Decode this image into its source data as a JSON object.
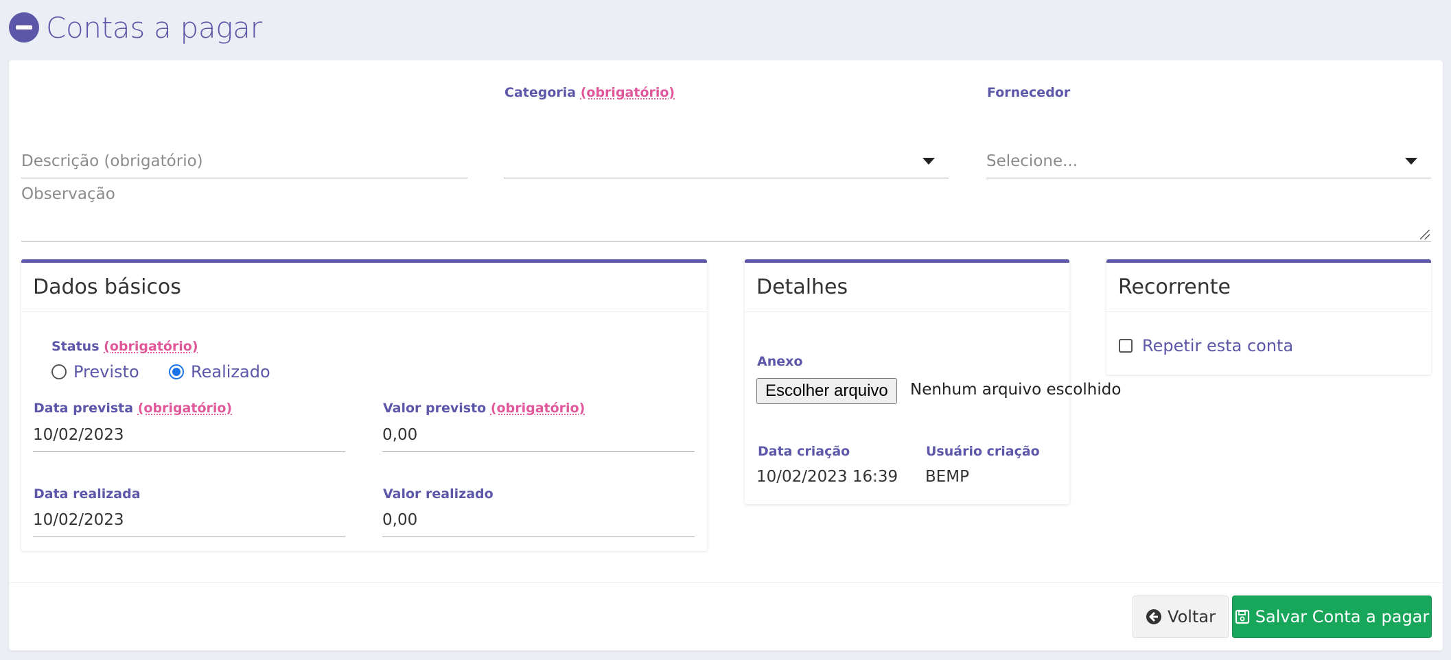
{
  "header": {
    "title": "Contas a pagar",
    "icon": "minus-circle-icon"
  },
  "form": {
    "descricao": {
      "placeholder": "Descrição  (obrigatório)"
    },
    "categoria": {
      "label": "Categoria",
      "required": "(obrigatório)",
      "value": ""
    },
    "fornecedor": {
      "label": "Fornecedor",
      "placeholder": "Selecione..."
    },
    "observacao": {
      "placeholder": "Observação"
    }
  },
  "dados_basicos": {
    "title": "Dados básicos",
    "status": {
      "label": "Status",
      "required": "(obrigatório)",
      "options": [
        "Previsto",
        "Realizado"
      ],
      "selected": "Realizado"
    },
    "data_prevista": {
      "label": "Data prevista",
      "required": "(obrigatório)",
      "value": "10/02/2023"
    },
    "valor_previsto": {
      "label": "Valor previsto",
      "required": "(obrigatório)",
      "value": "0,00"
    },
    "data_realizada": {
      "label": "Data realizada",
      "value": "10/02/2023"
    },
    "valor_realizado": {
      "label": "Valor realizado",
      "value": "0,00"
    }
  },
  "detalhes": {
    "title": "Detalhes",
    "anexo": {
      "label": "Anexo",
      "button": "Escolher arquivo",
      "status": "Nenhum arquivo escolhido"
    },
    "data_criacao": {
      "label": "Data criação",
      "value": "10/02/2023 16:39"
    },
    "usuario_criacao": {
      "label": "Usuário criação",
      "value": "BEMP"
    }
  },
  "recorrente": {
    "title": "Recorrente",
    "checkbox_label": "Repetir esta conta",
    "checked": false
  },
  "footer": {
    "back_label": "Voltar",
    "save_label": "Salvar Conta a pagar"
  },
  "colors": {
    "accent": "#5c57a8",
    "required": "#e0589a",
    "save": "#17a65a",
    "radio": "#1a73e8"
  }
}
